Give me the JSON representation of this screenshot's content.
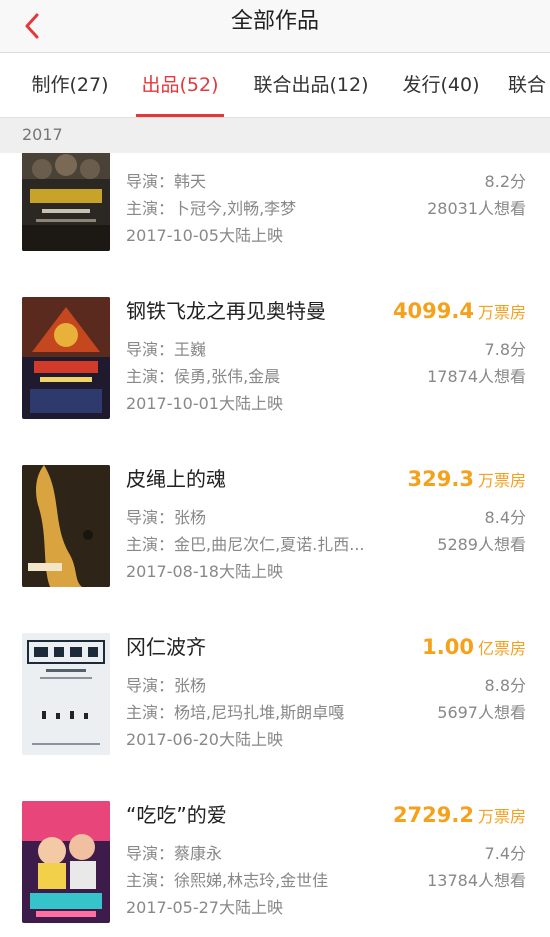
{
  "header": {
    "title": "全部作品",
    "back_icon": "chevron-left-icon",
    "accent_color": "#e5383b"
  },
  "tabs": [
    {
      "label": "制作(27)",
      "active": false
    },
    {
      "label": "出品(52)",
      "active": true
    },
    {
      "label": "联合出品(12)",
      "active": false
    },
    {
      "label": "发行(40)",
      "active": false
    },
    {
      "label": "联合",
      "active": false
    }
  ],
  "year": "2017",
  "movies": [
    {
      "title": "",
      "box_value": "",
      "box_unit": "",
      "director": "导演：韩天",
      "cast": "主演：卜冠今,刘畅,李梦",
      "release": "2017-10-05大陆上映",
      "score": "8.2分",
      "want": "28031人想看"
    },
    {
      "title": "钢铁飞龙之再见奥特曼",
      "box_value": "4099.4",
      "box_unit": "万票房",
      "director": "导演：王巍",
      "cast": "主演：侯勇,张伟,金晨",
      "release": "2017-10-01大陆上映",
      "score": "7.8分",
      "want": "17874人想看"
    },
    {
      "title": "皮绳上的魂",
      "box_value": "329.3",
      "box_unit": "万票房",
      "director": "导演：张杨",
      "cast": "主演：金巴,曲尼次仁,夏诺.扎西...",
      "release": "2017-08-18大陆上映",
      "score": "8.4分",
      "want": "5289人想看"
    },
    {
      "title": "冈仁波齐",
      "box_value": "1.00",
      "box_unit": "亿票房",
      "director": "导演：张杨",
      "cast": "主演：杨培,尼玛扎堆,斯朗卓嘎",
      "release": "2017-06-20大陆上映",
      "score": "8.8分",
      "want": "5697人想看"
    },
    {
      "title": "“吃吃”的爱",
      "box_value": "2729.2",
      "box_unit": "万票房",
      "director": "导演：蔡康永",
      "cast": "主演：徐熙娣,林志玲,金世佳",
      "release": "2017-05-27大陆上映",
      "score": "7.4分",
      "want": "13784人想看"
    }
  ]
}
